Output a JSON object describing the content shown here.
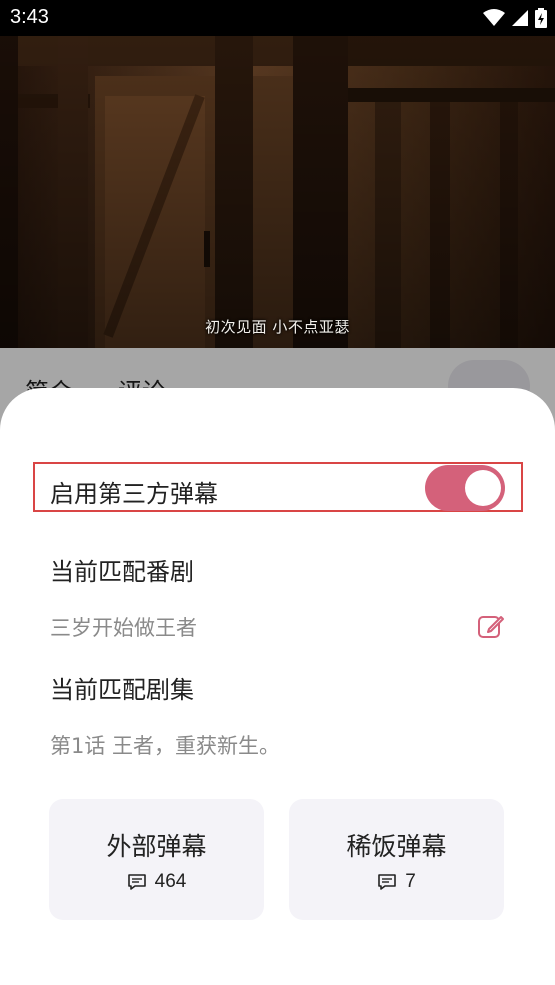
{
  "status_bar": {
    "time": "3:43",
    "icons": [
      "wifi-icon",
      "cell-signal-icon",
      "battery-icon"
    ]
  },
  "video": {
    "subtitle": "初次见面 小不点亚瑟"
  },
  "tabs": [
    {
      "label": "简介"
    },
    {
      "label": "评论"
    }
  ],
  "sheet": {
    "toggle": {
      "label": "启用第三方弹幕",
      "enabled": true,
      "accent": "#d4617a"
    },
    "anime": {
      "title": "当前匹配番剧",
      "value": "三岁开始做王者"
    },
    "episode": {
      "title": "当前匹配剧集",
      "value": "第1话 王者，重获新生。"
    },
    "cards": [
      {
        "label": "外部弹幕",
        "count": "464",
        "icon": "comment-icon"
      },
      {
        "label": "稀饭弹幕",
        "count": "7",
        "icon": "comment-icon"
      }
    ]
  },
  "highlight_color": "#d94545"
}
